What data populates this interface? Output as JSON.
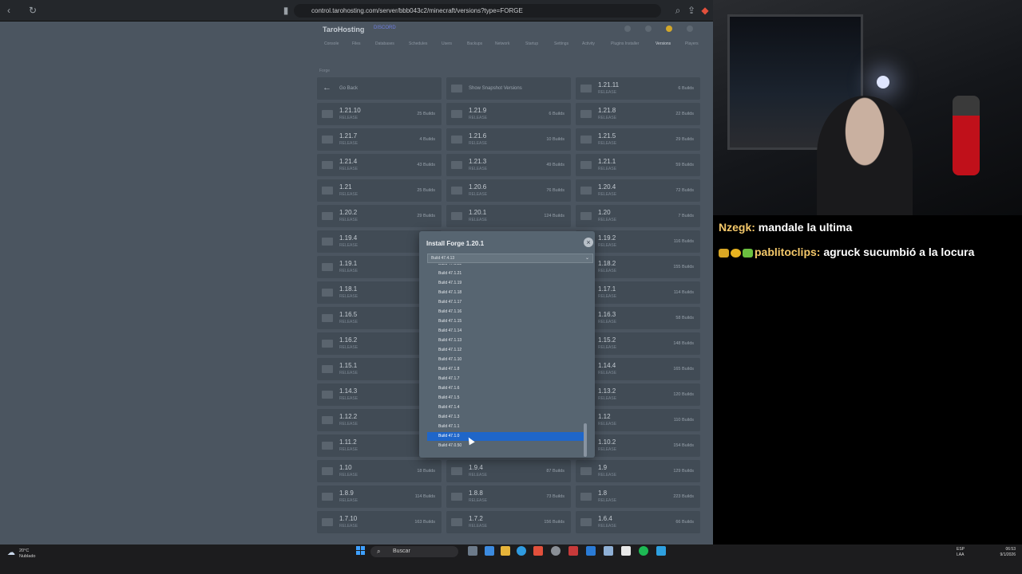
{
  "browser": {
    "url": "control.tarohosting.com/server/bbb043c2/minecraft/versions?type=FORGE"
  },
  "app": {
    "brand": "TaroHosting",
    "discord": "DISCORD",
    "tabs": [
      "Console",
      "Files",
      "Databases",
      "Schedules",
      "Users",
      "Backups",
      "Network",
      "Startup",
      "Settings",
      "Activity",
      "Plugins Installer",
      "Versions",
      "Players"
    ]
  },
  "section_label": "Forge",
  "nav_cards": {
    "back": "Go Back",
    "snapshot": "Show Snapshot Versions"
  },
  "release_label": "RELEASE",
  "versions": [
    {
      "v": "1.21.11",
      "b": "6 Builds"
    },
    {
      "v": "1.21.10",
      "b": "25 Builds"
    },
    {
      "v": "1.21.9",
      "b": "6 Builds"
    },
    {
      "v": "1.21.8",
      "b": "22 Builds"
    },
    {
      "v": "1.21.7",
      "b": "4 Builds"
    },
    {
      "v": "1.21.6",
      "b": "10 Builds"
    },
    {
      "v": "1.21.5",
      "b": "29 Builds"
    },
    {
      "v": "1.21.4",
      "b": "43 Builds"
    },
    {
      "v": "1.21.3",
      "b": "49 Builds"
    },
    {
      "v": "1.21.1",
      "b": "59 Builds"
    },
    {
      "v": "1.21",
      "b": "25 Builds"
    },
    {
      "v": "1.20.6",
      "b": "76 Builds"
    },
    {
      "v": "1.20.4",
      "b": "72 Builds"
    },
    {
      "v": "1.20.2",
      "b": "29 Builds"
    },
    {
      "v": "1.20.1",
      "b": "124 Builds"
    },
    {
      "v": "1.20",
      "b": "7 Builds"
    },
    {
      "v": "1.19.4",
      "b": ""
    },
    {
      "v": "",
      "b": ""
    },
    {
      "v": "1.19.2",
      "b": "116 Builds"
    },
    {
      "v": "1.19.1",
      "b": ""
    },
    {
      "v": "",
      "b": ""
    },
    {
      "v": "1.18.2",
      "b": "155 Builds"
    },
    {
      "v": "1.18.1",
      "b": ""
    },
    {
      "v": "",
      "b": ""
    },
    {
      "v": "1.17.1",
      "b": "114 Builds"
    },
    {
      "v": "1.16.5",
      "b": ""
    },
    {
      "v": "",
      "b": ""
    },
    {
      "v": "1.16.3",
      "b": "58 Builds"
    },
    {
      "v": "1.16.2",
      "b": ""
    },
    {
      "v": "",
      "b": ""
    },
    {
      "v": "1.15.2",
      "b": "148 Builds"
    },
    {
      "v": "1.15.1",
      "b": ""
    },
    {
      "v": "",
      "b": ""
    },
    {
      "v": "1.14.4",
      "b": "165 Builds"
    },
    {
      "v": "1.14.3",
      "b": ""
    },
    {
      "v": "",
      "b": ""
    },
    {
      "v": "1.13.2",
      "b": "120 Builds"
    },
    {
      "v": "1.12.2",
      "b": ""
    },
    {
      "v": "",
      "b": ""
    },
    {
      "v": "1.12",
      "b": "110 Builds"
    },
    {
      "v": "1.11.2",
      "b": ""
    },
    {
      "v": "",
      "b": ""
    },
    {
      "v": "1.10.2",
      "b": "154 Builds"
    },
    {
      "v": "1.10",
      "b": "18 Builds"
    },
    {
      "v": "1.9.4",
      "b": "87 Builds"
    },
    {
      "v": "1.9",
      "b": "129 Builds"
    },
    {
      "v": "1.8.9",
      "b": "114 Builds"
    },
    {
      "v": "1.8.8",
      "b": "73 Builds"
    },
    {
      "v": "1.8",
      "b": "223 Builds"
    },
    {
      "v": "1.7.10",
      "b": "163 Builds"
    },
    {
      "v": "1.7.2",
      "b": "156 Builds"
    },
    {
      "v": "1.6.4",
      "b": "66 Builds"
    }
  ],
  "modal": {
    "title": "Install Forge 1.20.1",
    "close": "×",
    "selected": "Build 47.4.13",
    "options": [
      "Build 47.1.22",
      "Build 47.1.21",
      "Build 47.1.19",
      "Build 47.1.18",
      "Build 47.1.17",
      "Build 47.1.16",
      "Build 47.1.15",
      "Build 47.1.14",
      "Build 47.1.13",
      "Build 47.1.12",
      "Build 47.1.10",
      "Build 47.1.8",
      "Build 47.1.7",
      "Build 47.1.6",
      "Build 47.1.5",
      "Build 47.1.4",
      "Build 47.1.3",
      "Build 47.1.1",
      "Build 47.1.0",
      "Build 47.0.50"
    ],
    "highlighted_index": 18
  },
  "chat": [
    {
      "user": "Nzegk:",
      "msg": "mandale la ultima"
    },
    {
      "user": "pablitoclips:",
      "msg": "agruck sucumbió a la locura"
    }
  ],
  "help": "?",
  "taskbar": {
    "temp": "20°C",
    "condition": "Nublado",
    "search": "Buscar",
    "lang1": "ESP",
    "lang2": "LAA",
    "time": "06:53",
    "date": "9/1/2026"
  },
  "colors": {
    "accent": "#1f66c9",
    "page_bg": "#4b5560",
    "card_bg": "#414b55"
  },
  "icons": [
    "back-icon",
    "reload-icon",
    "bookmark-icon",
    "search-icon",
    "close-icon",
    "chevron-down-icon",
    "arrow-left-icon",
    "windows-icon",
    "weather-icon"
  ]
}
